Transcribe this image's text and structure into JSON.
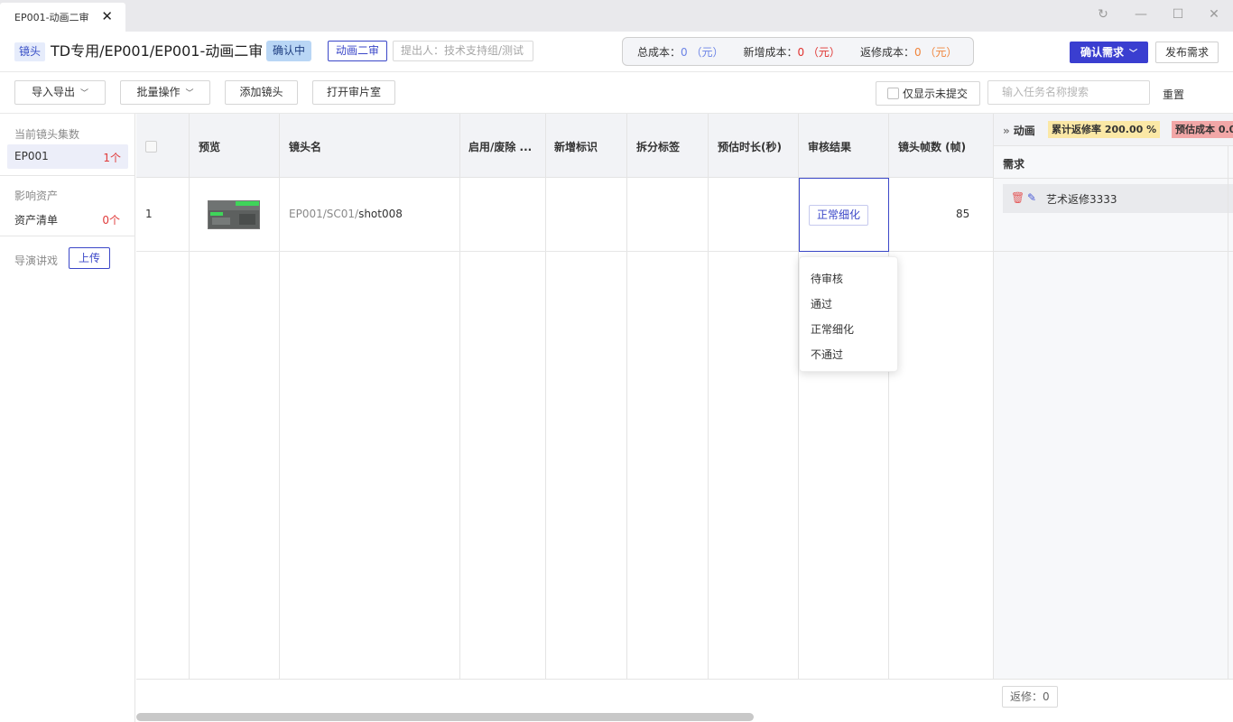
{
  "window": {
    "tab_title": "EP001-动画二审",
    "tab_close": "✕",
    "refresh_icon": "↻",
    "minimize_icon": "—",
    "maximize_icon": "☐",
    "close_icon": "✕"
  },
  "header": {
    "shot_tag": "镜头",
    "path_title": "TD专用/EP001/EP001-动画二审",
    "status_tag": "确认中",
    "stage_tag": "动画二审",
    "proposer": "提出人：技术支持组/测试",
    "cost": {
      "total_label": "总成本：",
      "total_value": "0 （元）",
      "new_label": "新增成本：",
      "new_value": "0 （元）",
      "rework_label": "返修成本：",
      "rework_value": "0 （元）"
    },
    "confirm_button": "确认需求",
    "publish_button": "发布需求"
  },
  "toolbar": {
    "import_export": "导入导出",
    "batch": "批量操作",
    "add_shot": "添加镜头",
    "open_review": "打开审片室",
    "only_unsubmitted": "仅显示未提交",
    "search_placeholder": "输入任务名称搜索",
    "reset": "重置"
  },
  "sidebar": {
    "current_label": "当前镜头集数",
    "episode": "EP001",
    "episode_count": "1个",
    "affect_label": "影响资产",
    "asset_list": "资产清单",
    "asset_count": "0个",
    "director_label": "导演讲戏",
    "upload": "上传"
  },
  "table": {
    "headers": {
      "preview": "预览",
      "shot_name": "镜头名",
      "enable": "启用/废除 ...",
      "new_mark": "新增标识",
      "split_tag": "拆分标签",
      "est_duration": "预估时长(秒)",
      "review_result": "审核结果",
      "frames": "镜头帧数 (帧)"
    },
    "rows": [
      {
        "index": "1",
        "shot_prefix": "EP001/SC01/",
        "shot_name": "shot008",
        "review_result": "正常细化",
        "frames": "85"
      }
    ],
    "animation": {
      "label": "动画",
      "rework_rate": "累计返修率 200.00 %",
      "est_cost": "预估成本 0.0",
      "requirement_header": "需求",
      "requirement_item": "艺术返修3333"
    },
    "footer_rework": "返修：0"
  },
  "dropdown": {
    "options": [
      "待审核",
      "通过",
      "正常细化",
      "不通过"
    ]
  }
}
